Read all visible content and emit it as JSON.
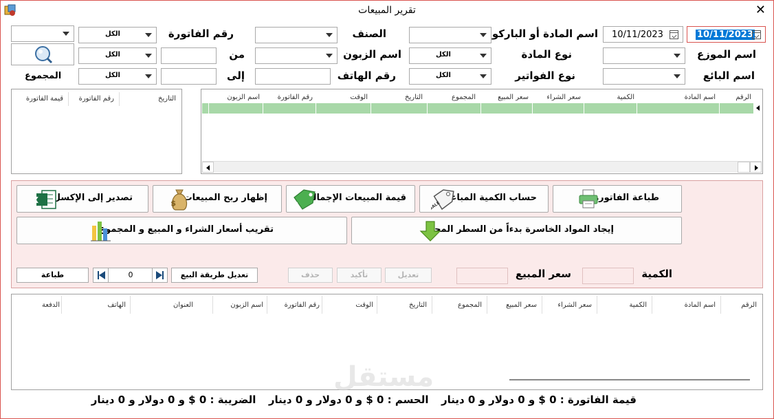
{
  "window": {
    "title": "تقرير المبيعات"
  },
  "filters": {
    "date_to": "10/11/2023",
    "date_from": "10/11/2023",
    "item_barcode_label": "اسم المادة أو الباركود",
    "category_label": "الصنف",
    "invoice_no_label": "رقم الفاتورة",
    "distributor_label": "اسم الموزع",
    "item_type_label": "نوع المادة",
    "item_type_value": "الكل",
    "customer_label": "اسم الزبون",
    "customer_value": "الكل",
    "from_label": "من",
    "seller_label": "اسم البائع",
    "invoice_type_label": "نوع الفواتير",
    "invoice_type_value": "الكل",
    "phone_label": "رقم الهاتف",
    "to_label": "إلى",
    "invoice_combo_value": "الكل",
    "from_combo_value": "الكل",
    "to_combo_value": "الكل",
    "total_label": "المجموع"
  },
  "main_grid": {
    "columns": [
      "الرقم",
      "اسم المادة",
      "الكمية",
      "سعر الشراء",
      "سعر المبيع",
      "المجموع",
      "التاريخ",
      "الوقت",
      "رقم الفاتورة",
      "اسم الزبون"
    ]
  },
  "side_grid": {
    "columns": [
      "التاريخ",
      "رقم الفاتورة",
      "قيمة الفاتورة"
    ]
  },
  "actions": {
    "print_invoice": "طباعة الفاتورة",
    "sold_quantity": "حساب الكمية المباعة",
    "total_sales": "قيمة المبيعات الإجمالية",
    "show_profit": "إظهار ربح المبيعات",
    "export_excel": "تصدير إلى الإكسل",
    "find_losing": "إيجاد المواد الخاسرة بدءاً من السطر المحدد",
    "round_prices": "تقريب أسعار الشراء و المبيع و المجموع"
  },
  "edit_row": {
    "quantity_label": "الكمية",
    "sale_price_label": "سعر المبيع",
    "edit": "تعديل",
    "confirm": "تأكيد",
    "delete": "حذف",
    "change_method": "تعديل طريقة البيع",
    "page_value": "0",
    "print": "طباعة"
  },
  "bottom_grid": {
    "columns": [
      "الرقم",
      "اسم المادة",
      "الكمية",
      "سعر الشراء",
      "سعر المبيع",
      "المجموع",
      "التاريخ",
      "الوقت",
      "رقم الفاتورة",
      "اسم الزبون",
      "العنوان",
      "الهاتف",
      "الدفعة"
    ]
  },
  "footer": {
    "invoice_value": "قيمة الفاتورة : 0 $ و 0 دولار و 0 دينار",
    "discount": "الحسم : 0 $ و 0 دولار و 0 دينار",
    "tax": "الضريبة : 0 $ و 0 دولار و 0 دينار"
  },
  "watermark": "مستقل"
}
